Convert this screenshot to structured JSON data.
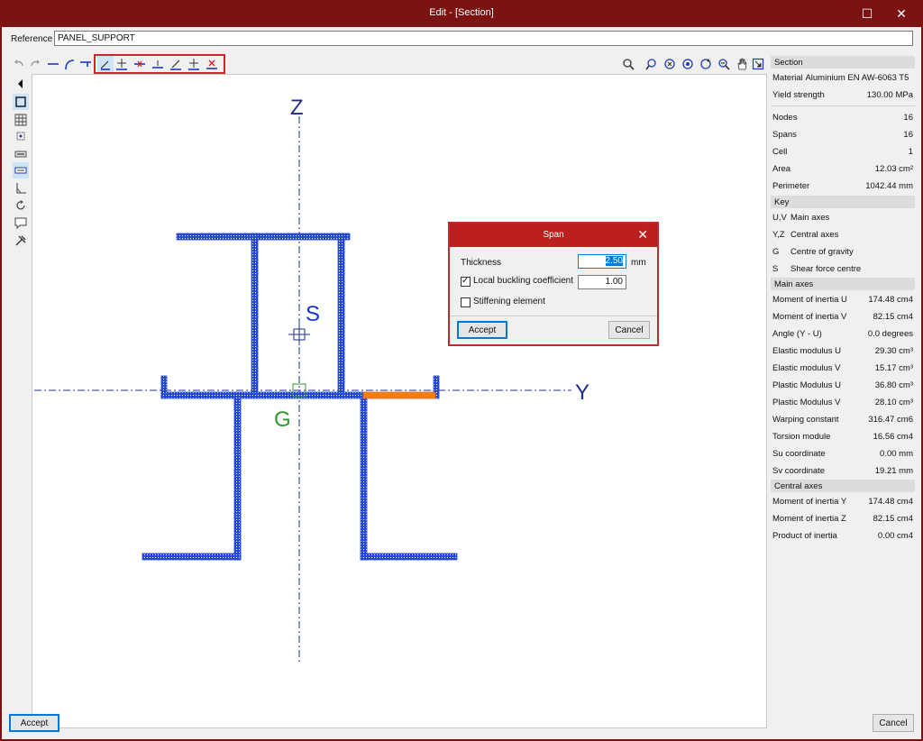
{
  "window": {
    "title": "Edit - [Section]",
    "maximize_glyph": "☐",
    "close_glyph": "✕"
  },
  "reference": {
    "label": "Reference",
    "value": "PANEL_SUPPORT"
  },
  "drawing": {
    "z_label": "Z",
    "y_label": "Y",
    "s_label": "S",
    "g_label": "G"
  },
  "colors": {
    "profile": "#2346d8",
    "selected_span": "#f07d1a",
    "axis": "#1d2c8c",
    "g": "#2e9a2e",
    "s": "#1535d8",
    "highlight": "#d6202b"
  },
  "panel": {
    "section_header": "Section",
    "material_label": "Material",
    "material_value": "Aluminium EN AW-6063 T5",
    "yield_label": "Yield strength",
    "yield_value": "130.00 MPa",
    "nodes_label": "Nodes",
    "nodes_value": "16",
    "spans_label": "Spans",
    "spans_value": "16",
    "cell_label": "Cell",
    "cell_value": "1",
    "area_label": "Area",
    "area_value": "12.03 cm²",
    "perimeter_label": "Perimeter",
    "perimeter_value": "1042.44 mm",
    "key_header": "Key",
    "key_uv": "U,V",
    "key_uv_text": "Main axes",
    "key_yz": "Y,Z",
    "key_yz_text": "Central axes",
    "key_g": "G",
    "key_g_text": "Centre of gravity",
    "key_s": "S",
    "key_s_text": "Shear force centre",
    "main_header": "Main axes",
    "mi_u_label": "Moment of inertia U",
    "mi_u_value": "174.48 cm4",
    "mi_v_label": "Moment of inertia V",
    "mi_v_value": "82.15 cm4",
    "angle_label": "Angle (Y - U)",
    "angle_value": "0.0 degrees",
    "em_u_label": "Elastic modulus U",
    "em_u_value": "29.30 cm³",
    "em_v_label": "Elastic modulus V",
    "em_v_value": "15.17 cm³",
    "pm_u_label": "Plastic Modulus U",
    "pm_u_value": "36.80 cm³",
    "pm_v_label": "Plastic Modulus V",
    "pm_v_value": "28.10 cm³",
    "warp_label": "Warping constant",
    "warp_value": "316.47 cm6",
    "tors_label": "Torsion module",
    "tors_value": "16.56 cm4",
    "su_label": "Su coordinate",
    "su_value": "0.00 mm",
    "sv_label": "Sv coordinate",
    "sv_value": "19.21 mm",
    "central_header": "Central axes",
    "mi_y_label": "Moment of inertia Y",
    "mi_y_value": "174.48 cm4",
    "mi_z_label": "Moment of inertia Z",
    "mi_z_value": "82.15 cm4",
    "prod_label": "Product of inertia",
    "prod_value": "0.00 cm4"
  },
  "dialog": {
    "title": "Span",
    "close_glyph": "✕",
    "thickness_label": "Thickness",
    "thickness_value": "2.50",
    "thickness_unit": "mm",
    "lbc_label": "Local buckling coefficient",
    "lbc_checked": true,
    "lbc_value": "1.00",
    "stiff_label": "Stiffening element",
    "stiff_checked": false,
    "accept_label": "Accept",
    "cancel_label": "Cancel"
  },
  "footer": {
    "accept_label": "Accept",
    "cancel_label": "Cancel"
  }
}
